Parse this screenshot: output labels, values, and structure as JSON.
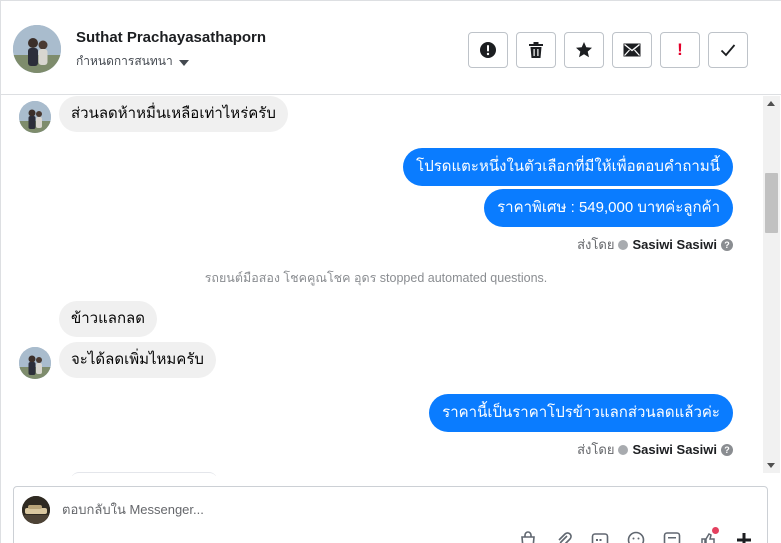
{
  "header": {
    "contact_name": "Suthat Prachayasathaporn",
    "assign_label": "กำหนดการสนทนา",
    "actions": [
      {
        "icon": "spam-icon"
      },
      {
        "icon": "trash-icon"
      },
      {
        "icon": "star-icon"
      },
      {
        "icon": "envelope-icon"
      },
      {
        "icon": "exclamation-icon",
        "glyph": "!",
        "color": "#e4002b"
      },
      {
        "icon": "check-icon"
      }
    ]
  },
  "thread": {
    "msg_in_1": "ส่วนลดห้าหมื่นเหลือเท่าไหร่ครับ",
    "msg_out_1": "โปรดแตะหนึ่งในตัวเลือกที่มีให้เพื่อตอบคำถามนี้",
    "msg_out_2": "ราคาพิเศษ : 549,000 บาทค่ะลูกค้า",
    "sent_by_prefix_1": "ส่งโดย",
    "sent_by_name_1": "Sasiwi Sasiwi",
    "system_notice": "รถยนต์มือสอง โชคคูณโชค อุดร stopped automated questions.",
    "msg_in_2": "ข้าวแลกลด",
    "msg_in_3": "จะได้ลดเพิ่มไหมครับ",
    "msg_out_3": "ราคานี้เป็นราคาโปรข้าวแลกส่วนลดแล้วค่ะ",
    "sent_by_prefix_2": "ส่งโดย",
    "sent_by_name_2": "Sasiwi Sasiwi"
  },
  "composer": {
    "placeholder": "ตอบกลับใน Messenger..."
  },
  "colors": {
    "outgoing_bubble": "#0a7cff",
    "incoming_bubble": "#f0f0f0",
    "alert_red": "#e4002b"
  }
}
